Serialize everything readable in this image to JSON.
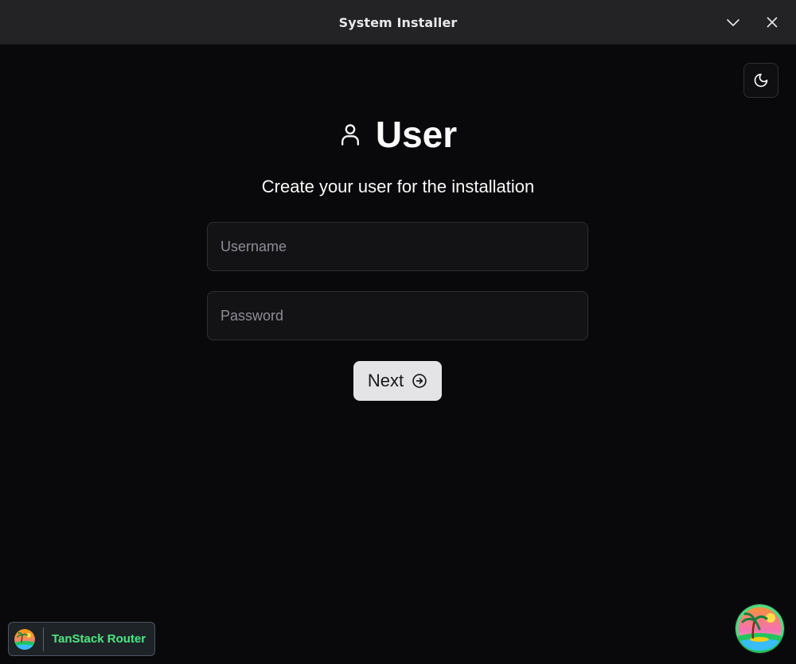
{
  "window": {
    "title": "System Installer"
  },
  "header": {
    "icon": "user-icon",
    "title": "User",
    "subtitle": "Create your user for the installation"
  },
  "form": {
    "username_placeholder": "Username",
    "password_placeholder": "Password",
    "next_label": "Next"
  },
  "devtools": {
    "label": "TanStack Router"
  },
  "theme": {
    "icon": "moon-icon"
  }
}
